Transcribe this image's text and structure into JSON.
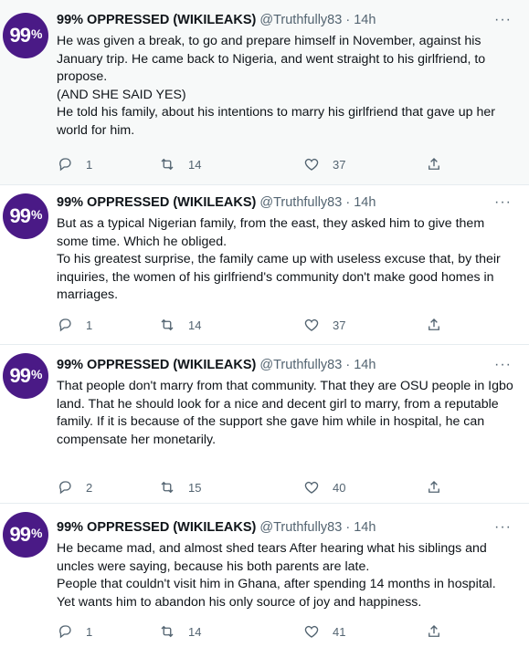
{
  "avatar_text": "99",
  "avatar_pct": "%",
  "tweets": [
    {
      "name": "99% OPPRESSED (WIKILEAKS)",
      "handle": "@Truthfully83",
      "time": "· 14h",
      "lines": [
        "He was given a break, to go and prepare himself in November, against his January trip. He came back to Nigeria, and went straight to his girlfriend, to propose.",
        "(AND SHE SAID YES)",
        "He told his family, about his intentions to marry his girlfriend that gave up her world for him."
      ],
      "replies": "1",
      "retweets": "14",
      "likes": "37"
    },
    {
      "name": "99% OPPRESSED (WIKILEAKS)",
      "handle": "@Truthfully83",
      "time": "· 14h",
      "lines": [
        "But as a typical Nigerian family, from the east, they asked him to give them some time. Which he obliged.",
        "To his greatest surprise, the family came up with useless excuse that, by their inquiries, the women of his girlfriend's community don't make good homes in marriages."
      ],
      "replies": "1",
      "retweets": "14",
      "likes": "37"
    },
    {
      "name": "99% OPPRESSED (WIKILEAKS)",
      "handle": "@Truthfully83",
      "time": "· 14h",
      "lines": [
        "That people don't marry from that community. That they are OSU people in Igbo land. That he should look for a nice and decent girl to marry, from a reputable family. If it is because of the support she gave him while in hospital, he can",
        "compensate her monetarily."
      ],
      "replies": "2",
      "retweets": "15",
      "likes": "40"
    },
    {
      "name": "99% OPPRESSED (WIKILEAKS)",
      "handle": "@Truthfully83",
      "time": "· 14h",
      "lines": [
        "He became mad, and almost shed tears After hearing what his siblings and uncles were saying, because his both parents are late.",
        "People that couldn't visit him in Ghana, after spending 14 months in hospital. Yet wants him to abandon his only source of joy and happiness."
      ],
      "replies": "1",
      "retweets": "14",
      "likes": "41"
    }
  ]
}
